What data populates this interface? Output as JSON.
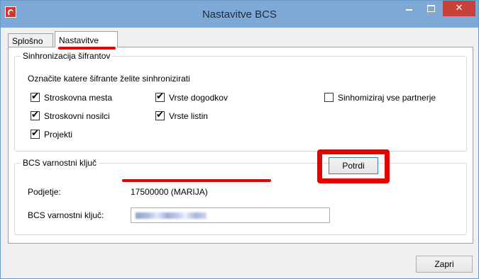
{
  "window": {
    "title": "Nastavitve BCS",
    "close_glyph": "✕"
  },
  "tabs": [
    {
      "label": "Splošno",
      "active": false
    },
    {
      "label": "Nastavitve",
      "active": true
    }
  ],
  "sync_group": {
    "legend": "Sinhronizacija šifrantov",
    "instruction": "Označite katere šifrante želite sinhronizirati",
    "checkboxes": [
      {
        "label": "Stroskovna mesta",
        "checked": true
      },
      {
        "label": "Stroskovni nosilci",
        "checked": true
      },
      {
        "label": "Projekti",
        "checked": true
      },
      {
        "label": "Vrste dogodkov",
        "checked": true
      },
      {
        "label": "Vrste listin",
        "checked": true
      },
      {
        "label": "Sinhomiziraj vse partnerje",
        "checked": false
      }
    ]
  },
  "key_group": {
    "legend": "BCS varnostni ključ",
    "company_label": "Podjetje:",
    "company_value": "17500000  (MARIJA)",
    "key_label": "BCS varnostni ključ:",
    "confirm_label": "Potrdi"
  },
  "footer": {
    "close_label": "Zapri"
  },
  "tick_glyph": "✔",
  "colors": {
    "titlebar": "#7ea9d6",
    "close_button": "#c8413b",
    "highlight": "#e60000"
  }
}
